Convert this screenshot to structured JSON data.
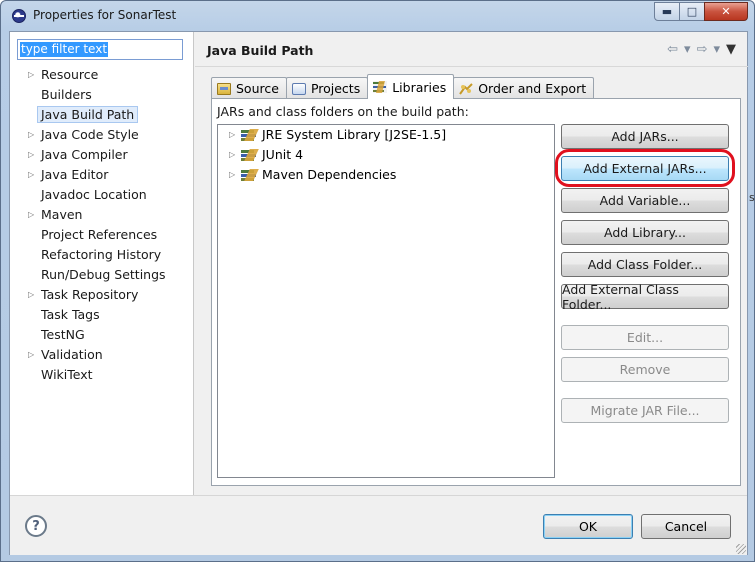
{
  "window": {
    "title": "Properties for SonarTest",
    "caption": {
      "minimize": "▭",
      "maximize": "□",
      "close": "✕"
    }
  },
  "sidebar": {
    "filter_value": "type filter text",
    "items": [
      {
        "label": "Resource",
        "expandable": true
      },
      {
        "label": "Builders",
        "expandable": false
      },
      {
        "label": "Java Build Path",
        "expandable": false,
        "selected": true
      },
      {
        "label": "Java Code Style",
        "expandable": true
      },
      {
        "label": "Java Compiler",
        "expandable": true
      },
      {
        "label": "Java Editor",
        "expandable": true
      },
      {
        "label": "Javadoc Location",
        "expandable": false
      },
      {
        "label": "Maven",
        "expandable": true
      },
      {
        "label": "Project References",
        "expandable": false
      },
      {
        "label": "Refactoring History",
        "expandable": false
      },
      {
        "label": "Run/Debug Settings",
        "expandable": false
      },
      {
        "label": "Task Repository",
        "expandable": true
      },
      {
        "label": "Task Tags",
        "expandable": false
      },
      {
        "label": "TestNG",
        "expandable": false
      },
      {
        "label": "Validation",
        "expandable": true
      },
      {
        "label": "WikiText",
        "expandable": false
      }
    ]
  },
  "page": {
    "title": "Java Build Path",
    "nav": {
      "back": "⇦",
      "back_menu": "▾",
      "forward": "⇨",
      "forward_menu": "▾",
      "view_menu": "▼"
    }
  },
  "tabs": [
    {
      "label": "Source",
      "icon": "source-folder-icon"
    },
    {
      "label": "Projects",
      "icon": "projects-icon"
    },
    {
      "label": "Libraries",
      "icon": "libraries-icon",
      "active": true
    },
    {
      "label": "Order and Export",
      "icon": "order-export-icon"
    }
  ],
  "libraries": {
    "caption": "JARs and class folders on the build path:",
    "entries": [
      "JRE System Library [J2SE-1.5]",
      "JUnit 4",
      "Maven Dependencies"
    ],
    "buttons": {
      "add_jars": "Add JARs...",
      "add_external_jars": "Add External JARs...",
      "add_variable": "Add Variable...",
      "add_library": "Add Library...",
      "add_class_folder": "Add Class Folder...",
      "add_external_class_folder": "Add External Class Folder...",
      "edit": "Edit...",
      "remove": "Remove",
      "migrate_jar": "Migrate JAR File..."
    }
  },
  "footer": {
    "help": "?",
    "ok": "OK",
    "cancel": "Cancel"
  },
  "offscreen_text": "s",
  "colors": {
    "highlight_ring": "#e0101e",
    "selection": "#3399ff"
  }
}
